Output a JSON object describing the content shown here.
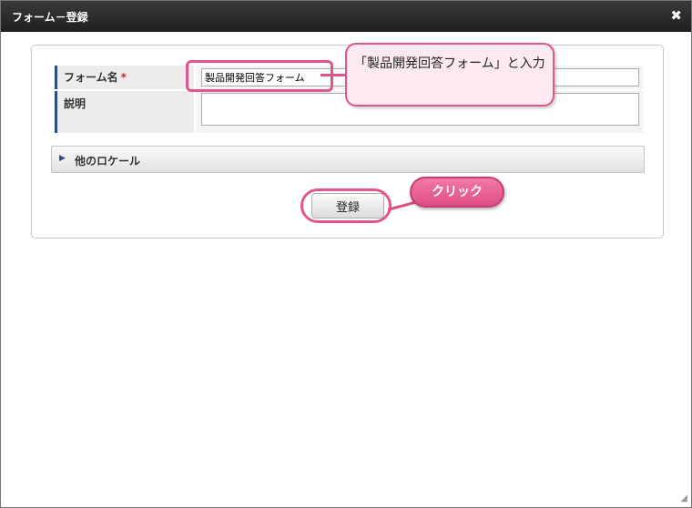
{
  "dialog": {
    "title": "フォーム－登録",
    "close_label": "✖"
  },
  "form": {
    "name_label": "フォーム名",
    "required_mark": "*",
    "name_value": "製品開発回答フォーム",
    "description_label": "説明",
    "description_value": "",
    "locale_toggle_icon": "▶",
    "locale_label": "他のロケール",
    "register_label": "登録"
  },
  "annotations": {
    "balloon_text": "「製品開発回答フォーム」と入力",
    "click_label": "クリック",
    "accent_color": "#e0568c"
  }
}
